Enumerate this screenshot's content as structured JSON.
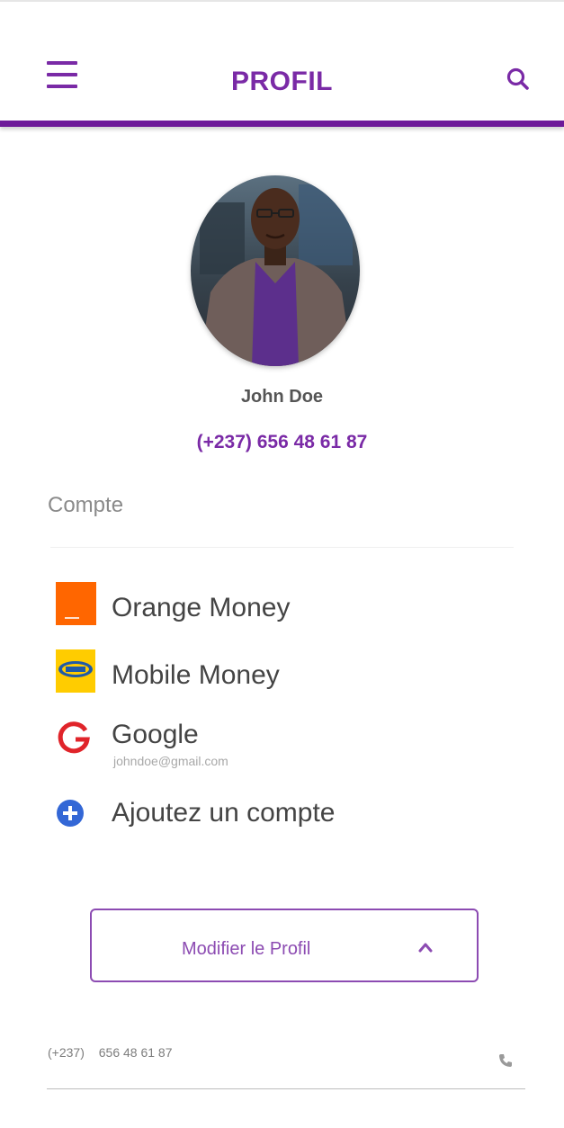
{
  "header": {
    "title": "PROFIL",
    "menu_icon": "menu-icon",
    "search_icon": "search-icon",
    "accent_color": "#7a2aa6"
  },
  "profile": {
    "avatar_icon": "profile-photo",
    "name": "John Doe",
    "phone": "(+237) 656 48 61 87"
  },
  "accounts": {
    "section_title": "Compte",
    "items": [
      {
        "label": "Orange Money",
        "icon": "orange-money-icon",
        "color": "#ff6600"
      },
      {
        "label": "Mobile Money",
        "icon": "mtn-mobile-money-icon",
        "color": "#ffcc00"
      },
      {
        "label": "Google",
        "sub": "johndoe@gmail.com",
        "icon": "google-icon",
        "color": "#e0242a"
      },
      {
        "label": "Ajoutez un compte",
        "icon": "plus-circle-icon",
        "color": "#3367d6"
      }
    ]
  },
  "edit_button": {
    "label": "Modifier le Profil",
    "icon": "chevron-up-icon"
  },
  "phone_field": {
    "code": "(+237)",
    "number": "656 48 61 87",
    "icon": "phone-icon"
  }
}
